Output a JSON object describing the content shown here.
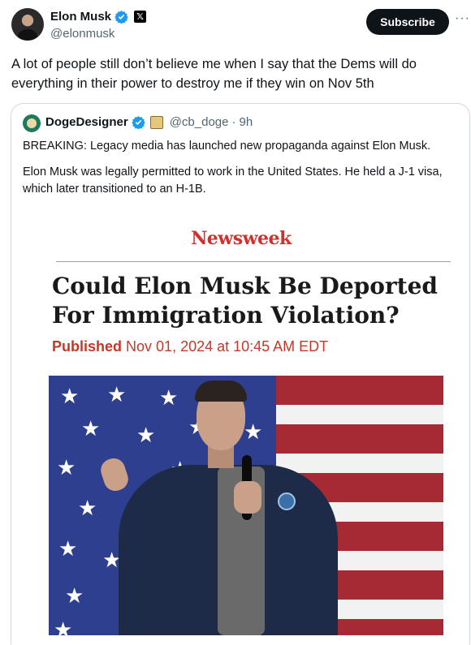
{
  "author": {
    "display_name": "Elon Musk",
    "handle": "@elonmusk",
    "badge_icon": "verified-badge-icon",
    "affiliation_icon": "x-logo-icon",
    "affiliation_glyph": "𝕏"
  },
  "actions": {
    "subscribe_label": "Subscribe",
    "more_label": "···"
  },
  "tweet": {
    "text": "A lot of people still don’t believe me when I say that the Dems will do everything in their power to destroy me if they win on Nov 5th"
  },
  "quote": {
    "display_name": "DogeDesigner",
    "handle": "@cb_doge",
    "separator": "·",
    "time": "9h",
    "paragraphs": [
      "BREAKING: Legacy media has launched new propaganda against Elon Musk.",
      "Elon Musk was legally permitted to work in the United States. He held a J-1 visa, which later transitioned to an H-1B."
    ]
  },
  "article": {
    "publisher": "Newsweek",
    "headline": "Could Elon Musk Be Deported For Immigration Violation?",
    "published_label": "Published",
    "published_date": "Nov 01, 2024 at 10:45 AM EDT"
  },
  "colors": {
    "verified_blue": "#1d9bf0",
    "newsweek_red": "#d0312d",
    "published_red": "#c0392b",
    "subscribe_bg": "#0f1419"
  }
}
